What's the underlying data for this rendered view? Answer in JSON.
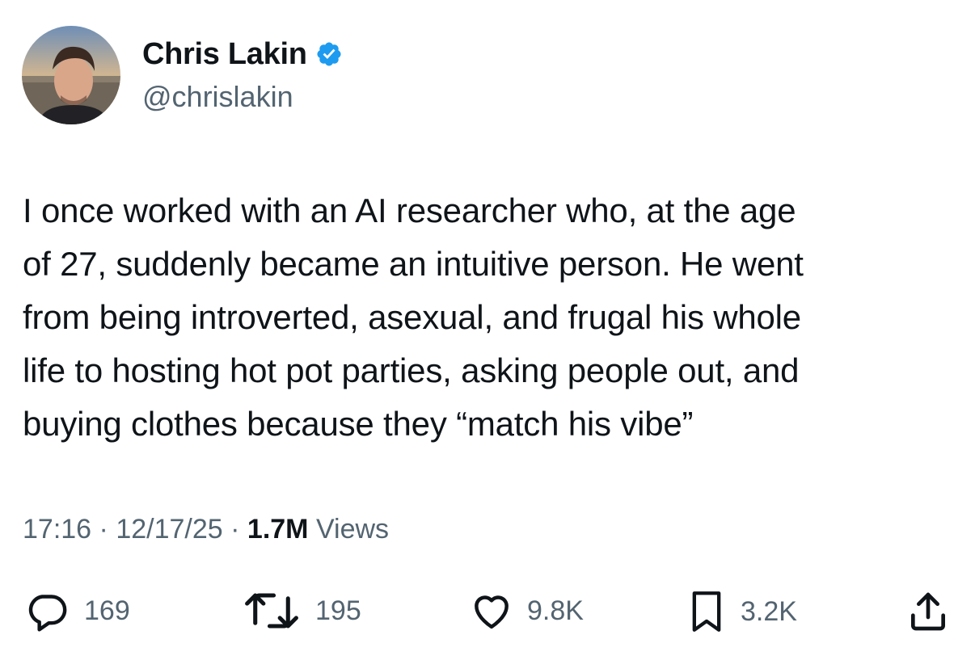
{
  "author": {
    "display_name": "Chris Lakin",
    "handle": "@chrislakin",
    "verified_icon": "verified-badge-icon",
    "badge_color": "#1d9bf0"
  },
  "tweet": {
    "text": "I once worked with an AI researcher who, at the age\nof 27, suddenly became an intuitive person. He went\nfrom being introverted, asexual, and frugal his whole\nlife to hosting hot pot parties, asking people out, and\nbuying clothes because they “match his vibe”"
  },
  "meta": {
    "time": "17:16",
    "date": "12/17/25",
    "separator": "·",
    "views_count": "1.7M",
    "views_label": "Views"
  },
  "actions": {
    "replies": {
      "icon": "reply-icon",
      "count": "169"
    },
    "reposts": {
      "icon": "repost-icon",
      "count": "195"
    },
    "likes": {
      "icon": "heart-icon",
      "count": "9.8K"
    },
    "bookmarks": {
      "icon": "bookmark-icon",
      "count": "3.2K"
    },
    "share": {
      "icon": "share-icon"
    }
  },
  "colors": {
    "text": "#0f1419",
    "secondary": "#536471"
  }
}
